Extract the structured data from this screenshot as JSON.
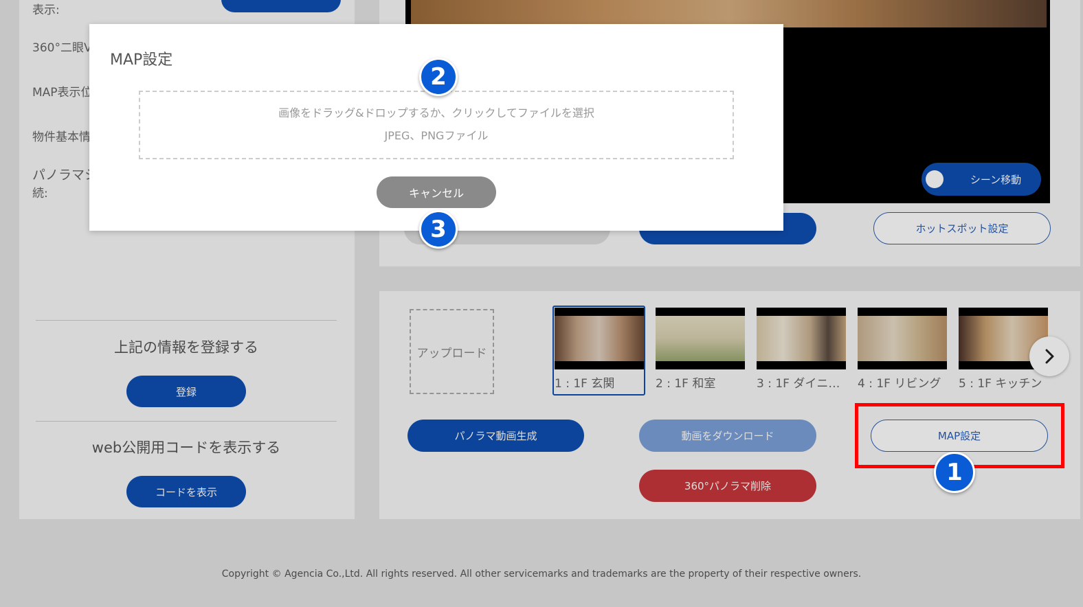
{
  "left_panel": {
    "display_label": "表示:",
    "stereo_label": "360°二眼V",
    "map_display_label": "MAP表示位",
    "property_label": "物件基本情",
    "panorama_label": "パノラマシ",
    "continue_label": "続:",
    "register_title": "上記の情報を登録する",
    "register_button": "登録",
    "web_code_title": "web公開用コードを表示する",
    "show_code_button": "コードを表示"
  },
  "viewer": {
    "scene_toggle_label": "シーン移動",
    "hotspot_button": "ホットスポット設定"
  },
  "scenes": {
    "upload_label": "アップロード",
    "items": [
      {
        "label": "1 : 1F 玄関"
      },
      {
        "label": "2 : 1F 和室"
      },
      {
        "label": "3 : 1F ダイニン..."
      },
      {
        "label": "4 : 1F リビング"
      },
      {
        "label": "5 : 1F キッチン"
      }
    ],
    "next_icon": "chevron-right-icon",
    "panorama_video_button": "パノラマ動画生成",
    "download_video_button": "動画をダウンロード",
    "map_settings_button": "MAP設定",
    "delete_button": "360°パノラマ削除"
  },
  "modal": {
    "title": "MAP設定",
    "dropzone_text": "画像をドラッグ&ドロップするか、クリックしてファイルを選択",
    "dropzone_formats": "JPEG、PNGファイル",
    "cancel_button": "キャンセル"
  },
  "annotations": {
    "badge1": "1",
    "badge2": "2",
    "badge3": "3"
  },
  "footer": {
    "copyright": "Copyright © Agencia Co.,Ltd. All rights reserved. All other servicemarks and trademarks are the property of their respective owners."
  },
  "colors": {
    "primary": "#0f4fb3",
    "danger": "#c8373b",
    "highlight": "#ff0000",
    "badge": "#0a5bd6"
  }
}
